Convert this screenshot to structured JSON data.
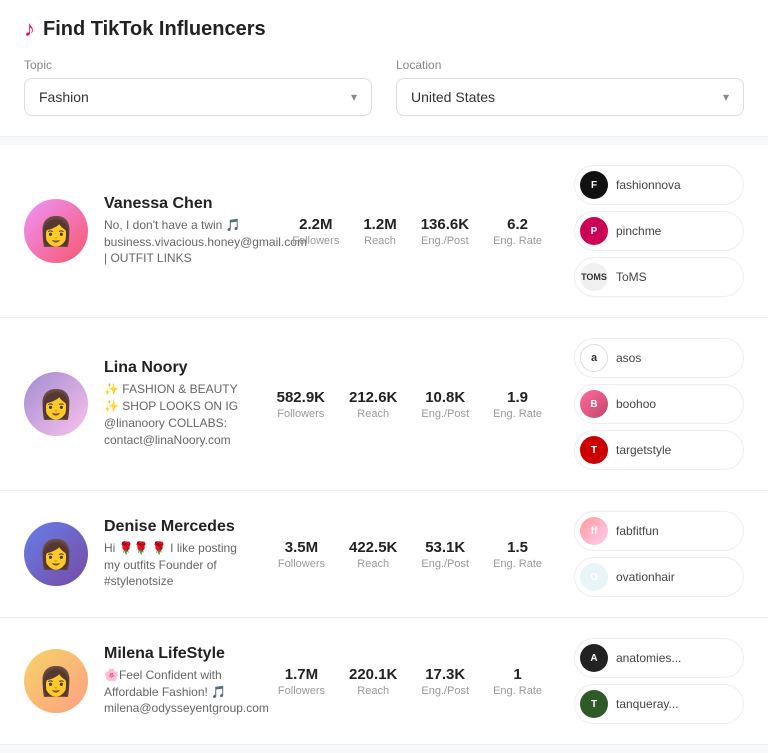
{
  "header": {
    "title": "Find TikTok Influencers",
    "tiktok_symbol": "♪",
    "topic_label": "Topic",
    "location_label": "Location",
    "topic_value": "Fashion",
    "location_value": "United States"
  },
  "influencers": [
    {
      "id": 1,
      "name": "Vanessa Chen",
      "bio": "No, I don't have a twin 🎵\nbusiness.vivacious.honey@gmail.com | OUTFIT LINKS",
      "stats": {
        "followers": "2.2M",
        "reach": "1.2M",
        "eng_post": "136.6K",
        "eng_rate": "6.2"
      },
      "brands": [
        {
          "name": "fashionnova",
          "logo_class": "logo-fashionnova",
          "symbol": "F"
        },
        {
          "name": "pinchme",
          "logo_class": "logo-pinchme",
          "symbol": "P"
        },
        {
          "name": "ToMS",
          "logo_class": "logo-toms",
          "symbol": "TOMS"
        }
      ],
      "avatar_class": "avatar-1",
      "avatar_symbol": "👩"
    },
    {
      "id": 2,
      "name": "Lina Noory",
      "bio": "✨ FASHION & BEAUTY ✨ SHOP LOOKS ON IG @linanoory\nCOLLABS: contact@linaNoory.com",
      "stats": {
        "followers": "582.9K",
        "reach": "212.6K",
        "eng_post": "10.8K",
        "eng_rate": "1.9"
      },
      "brands": [
        {
          "name": "asos",
          "logo_class": "logo-asos",
          "symbol": "a"
        },
        {
          "name": "boohoo",
          "logo_class": "logo-boohoo",
          "symbol": "B"
        },
        {
          "name": "targetstyle",
          "logo_class": "logo-targetstyle",
          "symbol": "T"
        }
      ],
      "avatar_class": "avatar-2",
      "avatar_symbol": "👩"
    },
    {
      "id": 3,
      "name": "Denise Mercedes",
      "bio": "Hi 🌹🌹 🌹 I like posting my outfits\nFounder of #stylenotsize",
      "stats": {
        "followers": "3.5M",
        "reach": "422.5K",
        "eng_post": "53.1K",
        "eng_rate": "1.5"
      },
      "brands": [
        {
          "name": "fabfitfun",
          "logo_class": "logo-fabfitfun",
          "symbol": "ff"
        },
        {
          "name": "ovationhair",
          "logo_class": "logo-ovationhair",
          "symbol": "O"
        }
      ],
      "avatar_class": "avatar-3",
      "avatar_symbol": "👩"
    },
    {
      "id": 4,
      "name": "Milena LifeStyle",
      "bio": "🌸Feel Confident with Affordable Fashion! 🎵\nmilena@odysseyentgroup.com",
      "stats": {
        "followers": "1.7M",
        "reach": "220.1K",
        "eng_post": "17.3K",
        "eng_rate": "1"
      },
      "brands": [
        {
          "name": "anatomies...",
          "logo_class": "logo-anatomies",
          "symbol": "A"
        },
        {
          "name": "tanqueray...",
          "logo_class": "logo-tanqueray",
          "symbol": "T"
        }
      ],
      "avatar_class": "avatar-4",
      "avatar_symbol": "👩"
    }
  ],
  "stat_labels": {
    "followers": "Followers",
    "reach": "Reach",
    "eng_post": "Eng./Post",
    "eng_rate": "Eng. Rate"
  }
}
